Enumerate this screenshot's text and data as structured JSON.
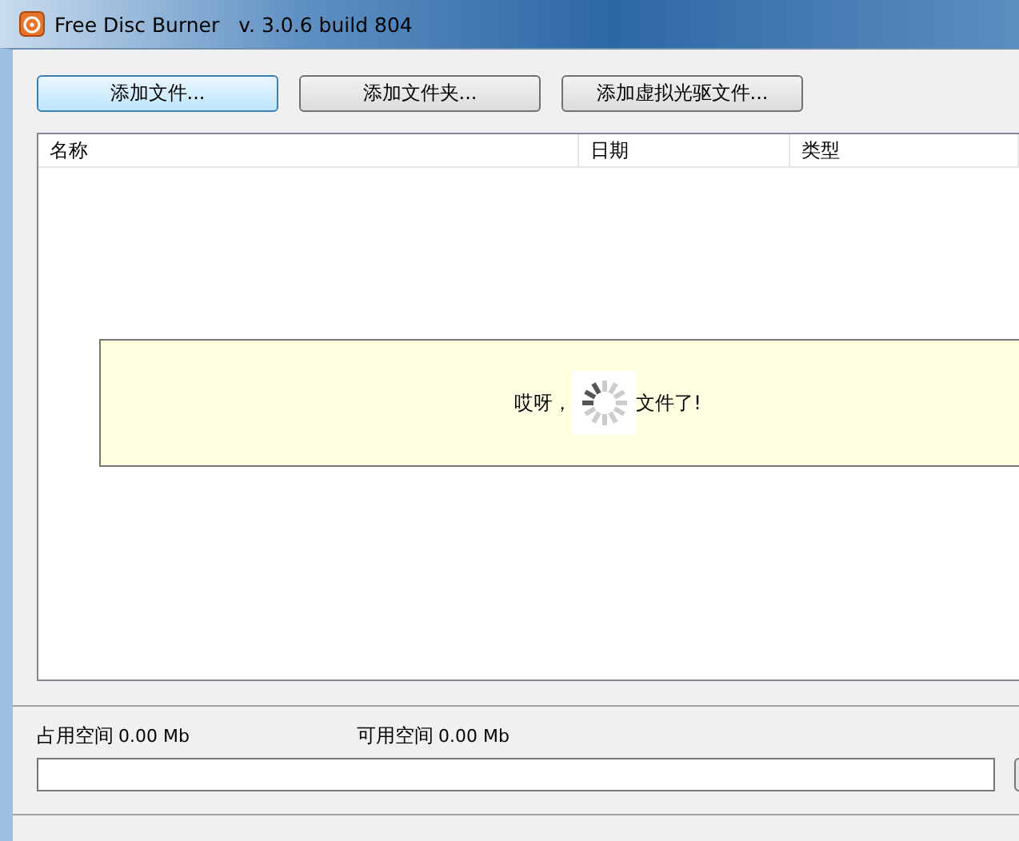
{
  "window": {
    "title": "Free Disc Burner",
    "version": "v. 3.0.6 build 804"
  },
  "buttons": [
    {
      "label": "添加文件...",
      "selected": true
    },
    {
      "label": "添加文件夹...",
      "selected": false
    },
    {
      "label": "添加虚拟光驱文件...",
      "selected": false
    }
  ],
  "table": {
    "columns": [
      "名称",
      "日期",
      "类型"
    ]
  },
  "message": {
    "before": "哎呀，",
    "after": "文件了!"
  },
  "status": [
    {
      "label": "占用空间",
      "value": "0.00 Mb"
    },
    {
      "label": "可用空间",
      "value": "0.00 Mb"
    }
  ],
  "progress": {
    "level": 0
  }
}
